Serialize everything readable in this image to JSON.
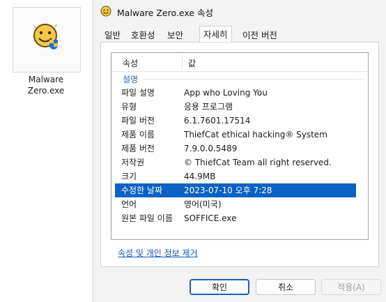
{
  "desktop_file": {
    "name_line1": "Malware",
    "name_line2": "Zero.exe"
  },
  "window": {
    "title": "Malware Zero.exe 속성"
  },
  "tabs": [
    {
      "label": "일반"
    },
    {
      "label": "호환성"
    },
    {
      "label": "보안"
    },
    {
      "label": "자세히"
    },
    {
      "label": "이전 버전"
    }
  ],
  "details": {
    "header_property": "속성",
    "header_value": "값",
    "section_label": "설명",
    "rows": [
      {
        "key": "파일 설명",
        "value": "App who Loving You"
      },
      {
        "key": "유형",
        "value": "응용 프로그램"
      },
      {
        "key": "파일 버전",
        "value": "6.1.7601.17514"
      },
      {
        "key": "제품 이름",
        "value": "ThiefCat ethical hacking® System"
      },
      {
        "key": "제품 버전",
        "value": "7.9.0.0.5489"
      },
      {
        "key": "저작권",
        "value": "© ThiefCat Team all right reserved."
      },
      {
        "key": "크기",
        "value": "44.9MB"
      },
      {
        "key": "수정한 날짜",
        "value": "2023-07-10 오후 7:28"
      },
      {
        "key": "언어",
        "value": "영어(미국)"
      },
      {
        "key": "원본 파일 이름",
        "value": "SOFFICE.exe"
      }
    ]
  },
  "remove_properties_link": "속성 및 개인 정보 제거",
  "buttons": {
    "ok": "확인",
    "cancel": "취소",
    "apply": "적용(A)"
  },
  "colors": {
    "selection": "#0a62c4",
    "link": "#0a57b5",
    "section": "#2a5fb0"
  }
}
